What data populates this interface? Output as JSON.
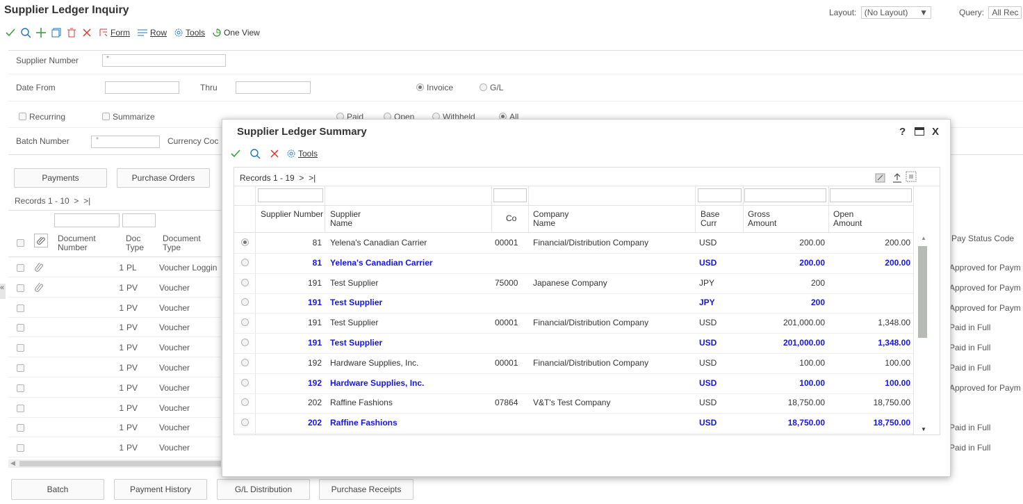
{
  "page": {
    "title": "Supplier Ledger Inquiry",
    "layout_label": "Layout:",
    "layout_value": "(No Layout)",
    "query_label": "Query:",
    "query_value": "All Rec"
  },
  "toolbar": {
    "form": "Form",
    "row": "Row",
    "tools": "Tools",
    "one_view": "One View"
  },
  "form": {
    "supplier_number_label": "Supplier Number",
    "supplier_number_value": "*",
    "date_from_label": "Date From",
    "thru_label": "Thru",
    "invoice_label": "Invoice",
    "gl_label": "G/L",
    "recurring_label": "Recurring",
    "summarize_label": "Summarize",
    "paid_label": "Paid",
    "open_label": "Open",
    "withheld_label": "Withheld",
    "all_label": "All",
    "batch_number_label": "Batch Number",
    "batch_number_value": "*",
    "currency_code_label": "Currency Coc"
  },
  "buttons": {
    "payments": "Payments",
    "purchase_orders": "Purchase Orders",
    "batch": "Batch",
    "payment_history": "Payment History",
    "gl_distribution": "G/L Distribution",
    "purchase_receipts": "Purchase Receipts"
  },
  "main_grid": {
    "records": "Records 1 - 10",
    "headers": {
      "doc_number": "Document Number",
      "doc_type": "Doc Type",
      "document_type": "Document Type",
      "pay_status": "Pay Status Code"
    },
    "rows": [
      {
        "number": "1",
        "type": "PL",
        "document_type": "Voucher Loggin",
        "status": "Approved for Paym"
      },
      {
        "number": "1",
        "type": "PV",
        "document_type": "Voucher",
        "status": "Approved for Paym"
      },
      {
        "number": "1",
        "type": "PV",
        "document_type": "Voucher",
        "status": "Approved for Paym"
      },
      {
        "number": "1",
        "type": "PV",
        "document_type": "Voucher",
        "status": "Paid in Full"
      },
      {
        "number": "1",
        "type": "PV",
        "document_type": "Voucher",
        "status": "Paid in Full"
      },
      {
        "number": "1",
        "type": "PV",
        "document_type": "Voucher",
        "status": "Paid in Full"
      },
      {
        "number": "1",
        "type": "PV",
        "document_type": "Voucher",
        "status": "Approved for Paym"
      },
      {
        "number": "1",
        "type": "PV",
        "document_type": "Voucher",
        "status": ""
      },
      {
        "number": "1",
        "type": "PV",
        "document_type": "Voucher",
        "status": "Paid in Full"
      },
      {
        "number": "1",
        "type": "PV",
        "document_type": "Voucher",
        "status": "Paid in Full"
      }
    ]
  },
  "modal": {
    "title": "Supplier Ledger Summary",
    "help": "?",
    "close": "X",
    "tools": "Tools",
    "records": "Records 1 - 19",
    "headers": {
      "supplier_number": "Supplier Number",
      "supplier_name": "Supplier Name",
      "co": "Co",
      "company_name": "Company Name",
      "base_curr": "Base Curr",
      "gross_amount": "Gross Amount",
      "open_amount": "Open Amount"
    },
    "rows": [
      {
        "number": "81",
        "name": "Yelena's Canadian Carrier",
        "co": "00001",
        "company": "Financial/Distribution Company",
        "curr": "USD",
        "gross": "200.00",
        "open": "200.00",
        "total": false,
        "selected": true
      },
      {
        "number": "81",
        "name": "Yelena's Canadian Carrier",
        "co": "",
        "company": "",
        "curr": "USD",
        "gross": "200.00",
        "open": "200.00",
        "total": true,
        "selected": false
      },
      {
        "number": "191",
        "name": "Test Supplier",
        "co": "75000",
        "company": "Japanese Company",
        "curr": "JPY",
        "gross": "200",
        "open": "",
        "total": false,
        "selected": false
      },
      {
        "number": "191",
        "name": "Test Supplier",
        "co": "",
        "company": "",
        "curr": "JPY",
        "gross": "200",
        "open": "",
        "total": true,
        "selected": false
      },
      {
        "number": "191",
        "name": "Test Supplier",
        "co": "00001",
        "company": "Financial/Distribution Company",
        "curr": "USD",
        "gross": "201,000.00",
        "open": "1,348.00",
        "total": false,
        "selected": false
      },
      {
        "number": "191",
        "name": "Test Supplier",
        "co": "",
        "company": "",
        "curr": "USD",
        "gross": "201,000.00",
        "open": "1,348.00",
        "total": true,
        "selected": false
      },
      {
        "number": "192",
        "name": "Hardware Supplies, Inc.",
        "co": "00001",
        "company": "Financial/Distribution Company",
        "curr": "USD",
        "gross": "100.00",
        "open": "100.00",
        "total": false,
        "selected": false
      },
      {
        "number": "192",
        "name": "Hardware Supplies, Inc.",
        "co": "",
        "company": "",
        "curr": "USD",
        "gross": "100.00",
        "open": "100.00",
        "total": true,
        "selected": false
      },
      {
        "number": "202",
        "name": "Raffine Fashions",
        "co": "07864",
        "company": "V&T's Test Company",
        "curr": "USD",
        "gross": "18,750.00",
        "open": "18,750.00",
        "total": false,
        "selected": false
      },
      {
        "number": "202",
        "name": "Raffine Fashions",
        "co": "",
        "company": "",
        "curr": "USD",
        "gross": "18,750.00",
        "open": "18,750.00",
        "total": true,
        "selected": false
      }
    ]
  },
  "colors": {
    "accent_green": "#3aa13a",
    "accent_blue": "#1a73c8",
    "total_row_blue": "#1515e0",
    "close_red": "#d9342b"
  }
}
